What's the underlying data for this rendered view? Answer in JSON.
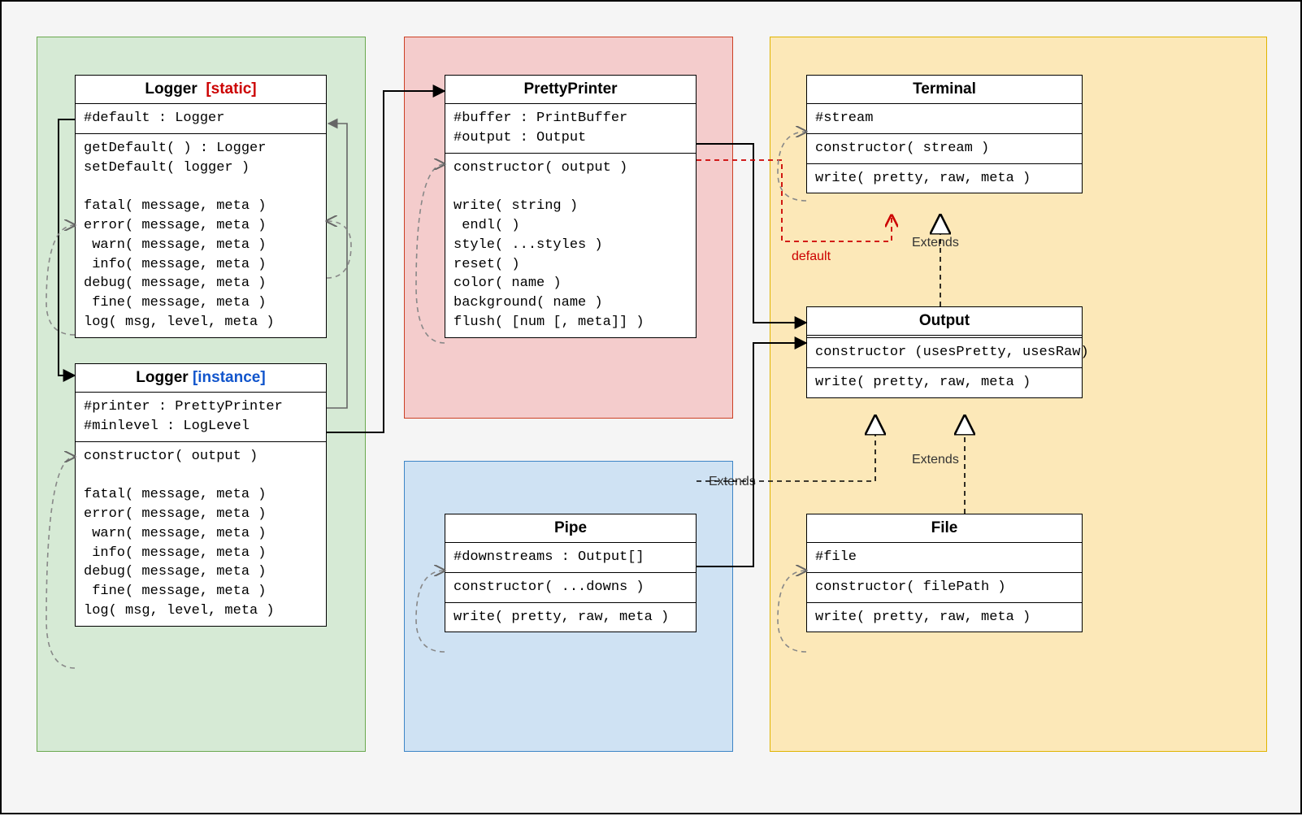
{
  "loggerStatic": {
    "title": "Logger",
    "tag": "[static]",
    "attrs": "#default : Logger",
    "ops": "getDefault( ) : Logger\nsetDefault( logger )\n\nfatal( message, meta )\nerror( message, meta )\n warn( message, meta )\n info( message, meta )\ndebug( message, meta )\n fine( message, meta )\nlog( msg, level, meta )"
  },
  "loggerInstance": {
    "title": "Logger",
    "tag": "[instance]",
    "attrs": "#printer : PrettyPrinter\n#minlevel : LogLevel",
    "ops": "constructor( output )\n\nfatal( message, meta )\nerror( message, meta )\n warn( message, meta )\n info( message, meta )\ndebug( message, meta )\n fine( message, meta )\nlog( msg, level, meta )"
  },
  "prettyPrinter": {
    "title": "PrettyPrinter",
    "attrs": "#buffer : PrintBuffer\n#output : Output",
    "ops": "constructor( output )\n\nwrite( string )\n endl( )\nstyle( ...styles )\nreset( )\ncolor( name )\nbackground( name )\nflush( [num [, meta]] )"
  },
  "terminal": {
    "title": "Terminal",
    "attrs": "#stream",
    "ops1": "constructor( stream )",
    "ops2": "write( pretty, raw, meta )"
  },
  "output": {
    "title": "Output",
    "ops1": "constructor (usesPretty, usesRaw)",
    "ops2": "write( pretty, raw, meta )"
  },
  "pipe": {
    "title": "Pipe",
    "attrs": "#downstreams : Output[]",
    "ops1": "constructor( ...downs )",
    "ops2": "write( pretty, raw, meta )"
  },
  "file": {
    "title": "File",
    "attrs": "#file",
    "ops1": "constructor( filePath )",
    "ops2": "write( pretty, raw, meta )"
  },
  "labels": {
    "extends1": "Extends",
    "extends2": "Extends",
    "extends3": "Extends",
    "default": "default"
  }
}
